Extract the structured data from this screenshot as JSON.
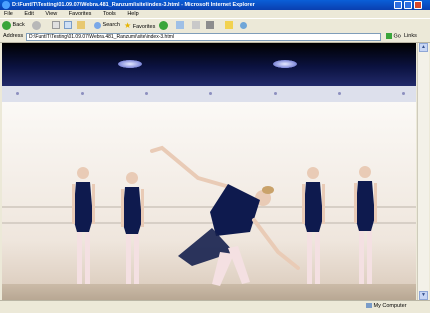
{
  "window": {
    "title": "D:\\FuntIT\\Testing\\01.09.07\\Webra.481_Ranzumi\\site\\index-3.html - Microsoft Internet Explorer"
  },
  "menu": [
    "File",
    "Edit",
    "View",
    "Favorites",
    "Tools",
    "Help"
  ],
  "toolbar": {
    "back_label": "Back",
    "search_label": "Search",
    "favorites_label": "Favorites"
  },
  "address": {
    "label": "Address",
    "value": "D:\\FuntIT\\Testing\\01.09.07\\Webra.481_Ranzumi\\site\\index-3.html",
    "go_label": "Go",
    "links_label": "Links"
  },
  "status": {
    "zone": "My Computer"
  },
  "colors": {
    "header_bg": "#0b1240",
    "nav_strip": "#dde0ec",
    "leotard": "#0e1a4e"
  }
}
